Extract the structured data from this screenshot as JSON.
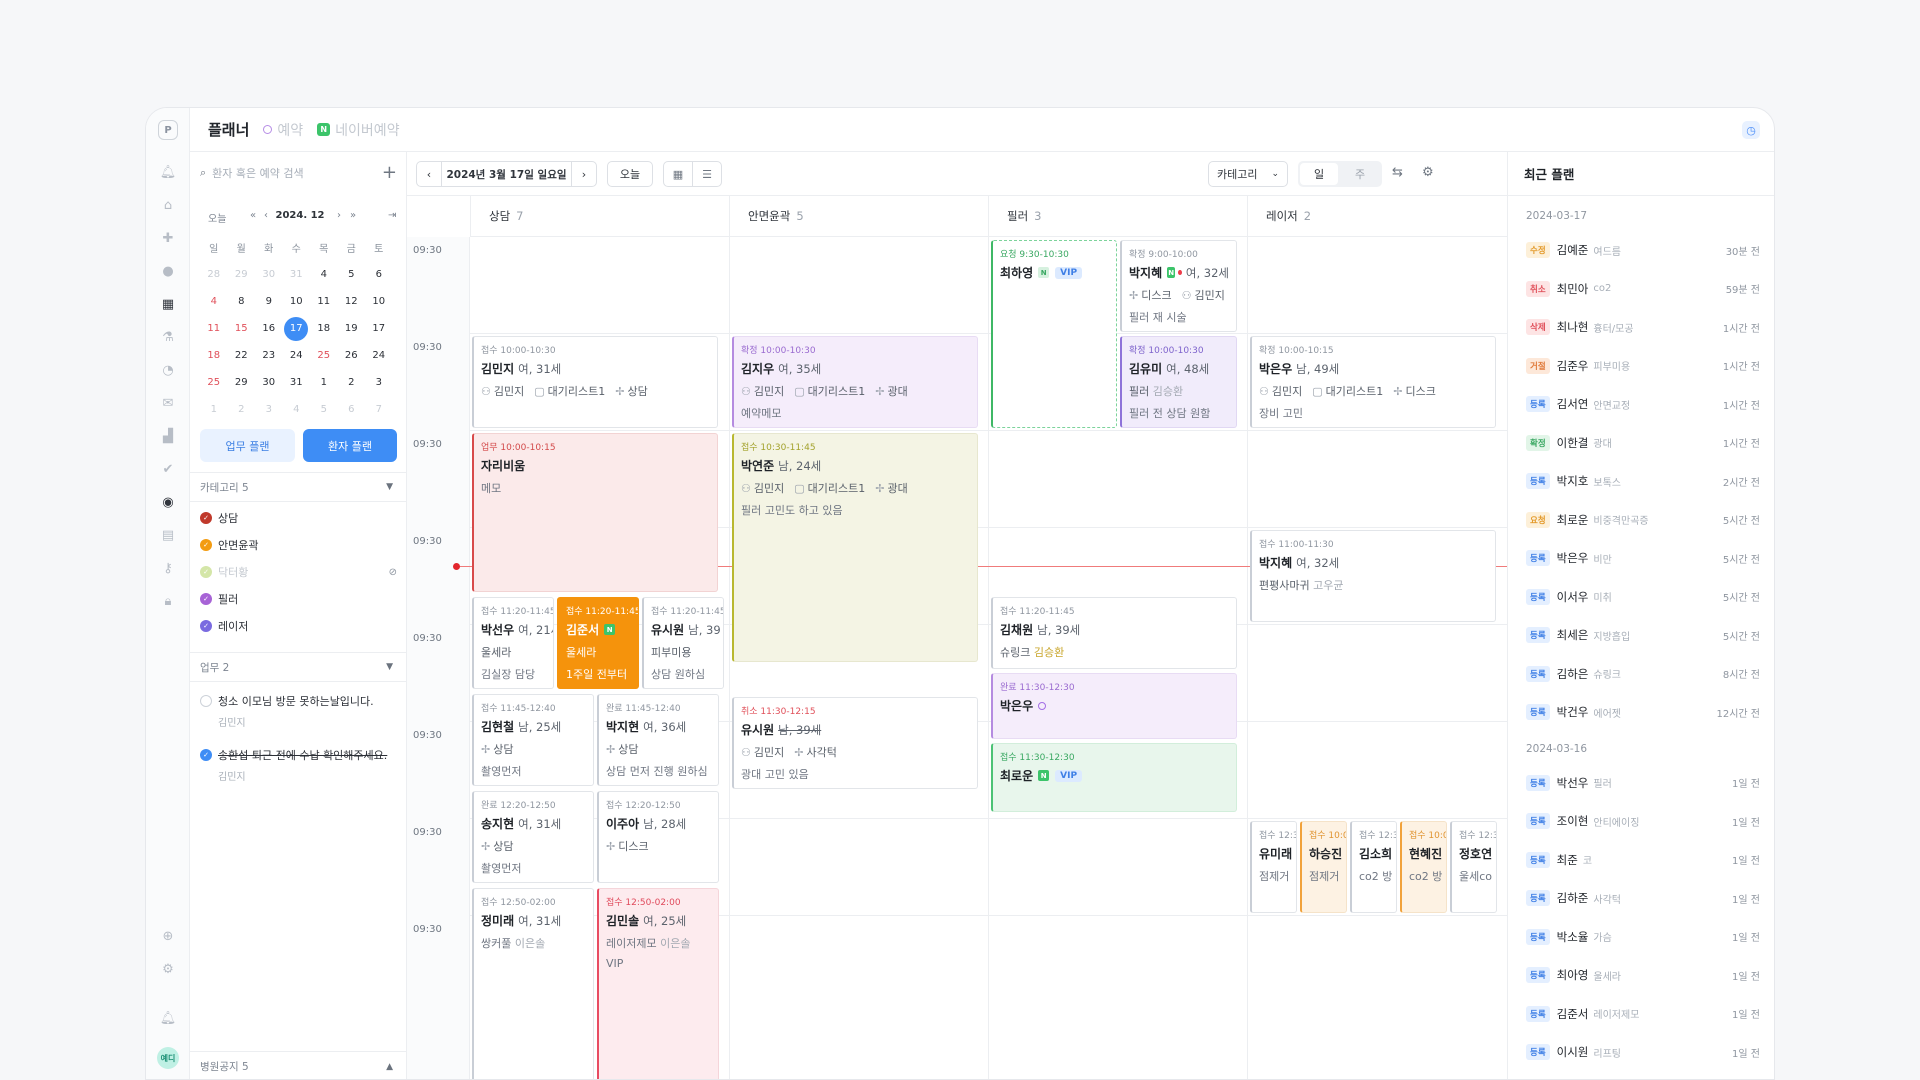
{
  "rail": {
    "logo": "P",
    "avatar": "예디"
  },
  "header": {
    "title": "플래너",
    "tab_reservation": "예약",
    "tab_naver": "네이버예약",
    "naver_letter": "N"
  },
  "search": {
    "placeholder": "환자 혹은 예약 검색",
    "plus": "+"
  },
  "calendar": {
    "today": "오늘",
    "prev_year": "«",
    "prev_month": "‹",
    "month": "2024. 12",
    "next_month": "›",
    "next_year": "»",
    "last": "⇥",
    "weekdays": [
      "일",
      "월",
      "화",
      "수",
      "목",
      "금",
      "토"
    ],
    "weeks": [
      [
        "28",
        "29",
        "30",
        "31",
        "4",
        "5",
        "6"
      ],
      [
        "4",
        "8",
        "9",
        "10",
        "11",
        "12",
        "10"
      ],
      [
        "11",
        "15",
        "16",
        "17",
        "18",
        "19",
        "17"
      ],
      [
        "18",
        "22",
        "23",
        "24",
        "25",
        "26",
        "24"
      ],
      [
        "25",
        "29",
        "30",
        "31",
        "1",
        "2",
        "3"
      ],
      [
        "1",
        "2",
        "3",
        "4",
        "5",
        "6",
        "7"
      ]
    ]
  },
  "plan_buttons": {
    "work": "업무 플랜",
    "patient": "환자 플랜"
  },
  "categories_section": {
    "title": "카테고리 5",
    "items": [
      {
        "label": "상담",
        "color": "#c0392b"
      },
      {
        "label": "안면윤곽",
        "color": "#f39c12"
      },
      {
        "label": "닥터황",
        "color": "#d4e6a8"
      },
      {
        "label": "필러",
        "color": "#a763d6"
      },
      {
        "label": "레이저",
        "color": "#7a6be0"
      }
    ]
  },
  "work_section": {
    "title": "업무 2",
    "items": [
      {
        "text": "청소 이모님 방문 못하는날입니다.",
        "sub": "김민지"
      },
      {
        "text": "송환섭 퇴근 전에 수납 확인해주세요.",
        "sub": "김민지"
      }
    ]
  },
  "notice_section": {
    "title": "병원공지 5"
  },
  "toolbar": {
    "prev": "‹",
    "date": "2024년 3월 17일 일요일",
    "next": "›",
    "today": "오늘",
    "category": "카테고리",
    "day": "일",
    "week": "주"
  },
  "columns": [
    {
      "name": "상담",
      "count": "7"
    },
    {
      "name": "안면윤곽",
      "count": "5"
    },
    {
      "name": "필러",
      "count": "3"
    },
    {
      "name": "레이저",
      "count": "2"
    }
  ],
  "time_labels": [
    "09:30",
    "09:30",
    "09:30",
    "09:30",
    "09:30",
    "09:30",
    "09:30",
    "09:30"
  ],
  "cards": {
    "c1": {
      "st": "접수 10:00-10:30",
      "nm": "김민지",
      "info": "여, 31세",
      "a": "김민지",
      "b": "대기리스트1",
      "c": "상담"
    },
    "c2": {
      "st": "업무 10:00-10:15",
      "nm": "자리비움",
      "memo": "메모"
    },
    "c3": {
      "st": "접수 11:20-11:45",
      "nm": "박선우",
      "info": "여, 21세",
      "r1": "울세라",
      "r2": "김실장 담당"
    },
    "c4": {
      "st": "접수 11:20-11:45",
      "nm": "김준서",
      "r1": "울세라",
      "r2": "1주일 전부터"
    },
    "c5": {
      "st": "접수 11:20-11:45",
      "nm": "유시원",
      "info": "남, 39",
      "r1": "피부미용",
      "r2": "상담 원하심"
    },
    "c6": {
      "st": "접수 11:45-12:40",
      "nm": "김현철",
      "info": "남, 25세",
      "c": "상담",
      "memo": "촬영먼저"
    },
    "c7": {
      "st": "완료 11:45-12:40",
      "nm": "박지현",
      "info": "여, 36세",
      "c": "상담",
      "memo": "상담 먼저 진행 원하심"
    },
    "c8": {
      "st": "완료 12:20-12:50",
      "nm": "송지현",
      "info": "여, 31세",
      "c": "상담",
      "memo": "촬영먼저"
    },
    "c9": {
      "st": "접수 12:20-12:50",
      "nm": "이주아",
      "info": "남, 28세",
      "c": "디스크"
    },
    "c10": {
      "st": "접수 12:50-02:00",
      "nm": "정미래",
      "info": "여, 31세",
      "memo": "쌍커풀",
      "who": "이은솔"
    },
    "c11": {
      "st": "접수 12:50-02:00",
      "nm": "김민솔",
      "info": "여, 25세",
      "memo": "레이저제모",
      "who": "이은솔",
      "extra": "VIP"
    },
    "d1": {
      "st": "확정 10:00-10:30",
      "nm": "김지우",
      "info": "여, 35세",
      "a": "김민지",
      "b": "대기리스트1",
      "c": "광대",
      "memo": "예약메모"
    },
    "d2": {
      "st": "접수 10:30-11:45",
      "nm": "박연준",
      "info": "남, 24세",
      "a": "김민지",
      "b": "대기리스트1",
      "c": "광대",
      "memo": "필러 고민도 하고 있음"
    },
    "d3": {
      "st": "취소 11:30-12:15",
      "nm": "유시원",
      "info": "남, 39세",
      "a": "김민지",
      "c": "사각턱",
      "memo": "광대 고민 있음"
    },
    "e1": {
      "st": "요청 9:30-10:30",
      "nm": "최하영",
      "vip": "VIP"
    },
    "e2": {
      "st": "확정 9:00-10:00",
      "nm": "박지혜",
      "info": "여, 32세",
      "c": "디스크",
      "a": "김민지",
      "memo": "필러 재 시술"
    },
    "e3": {
      "st": "확정 10:00-10:30",
      "nm": "김유미",
      "info": "여, 48세",
      "r1": "필러",
      "r1b": "김승환",
      "memo": "필러 전 상담 원함"
    },
    "e4": {
      "st": "접수 11:20-11:45",
      "nm": "김채원",
      "info": "남, 39세",
      "r1": "슈링크",
      "r1b": "김승환"
    },
    "e5": {
      "st": "완료 11:30-12:30",
      "nm": "박은우"
    },
    "e6": {
      "st": "접수 11:30-12:30",
      "nm": "최로운",
      "vip": "VIP"
    },
    "f1": {
      "st": "확정 10:00-10:15",
      "nm": "박은우",
      "info": "남, 49세",
      "a": "김민지",
      "b": "대기리스트1",
      "c": "디스크",
      "memo": "장비 고민"
    },
    "f2": {
      "st": "접수 11:00-11:30",
      "nm": "박지혜",
      "info": "여, 32세",
      "memo": "편평사마귀",
      "who": "고우균"
    },
    "g1": {
      "st": "접수 12:3",
      "nm": "유미래",
      "r1": "점제거"
    },
    "g2": {
      "st": "접수 10:0",
      "nm": "하승진",
      "r1": "점제거"
    },
    "g3": {
      "st": "접수 12:3",
      "nm": "김소희",
      "r1": "co2 방"
    },
    "g4": {
      "st": "접수 10:0",
      "nm": "현혜진",
      "r1": "co2 방"
    },
    "g5": {
      "st": "접수 12:3",
      "nm": "정호연",
      "r1": "울세co"
    }
  },
  "recent": {
    "title": "최근 플랜",
    "groups": [
      {
        "date": "2024-03-17",
        "items": [
          {
            "tag": "수정",
            "name": "김예준",
            "txt": "여드름",
            "ago": "30분 전"
          },
          {
            "tag": "취소",
            "name": "최민아",
            "txt": "co2",
            "ago": "59분 전"
          },
          {
            "tag": "삭제",
            "name": "최나현",
            "txt": "흉터/모공",
            "ago": "1시간 전"
          },
          {
            "tag": "거절",
            "name": "김준우",
            "txt": "피부미용",
            "ago": "1시간 전"
          },
          {
            "tag": "등록",
            "name": "김서연",
            "txt": "안면교정",
            "ago": "1시간 전"
          },
          {
            "tag": "확정",
            "name": "이한결",
            "txt": "광대",
            "ago": "1시간 전"
          },
          {
            "tag": "등록",
            "name": "박지호",
            "txt": "보톡스",
            "ago": "2시간 전"
          },
          {
            "tag": "요청",
            "name": "최로운",
            "txt": "비중격만곡증",
            "ago": "5시간 전"
          },
          {
            "tag": "등록",
            "name": "박은우",
            "txt": "비만",
            "ago": "5시간 전"
          },
          {
            "tag": "등록",
            "name": "이서우",
            "txt": "미취",
            "ago": "5시간 전"
          },
          {
            "tag": "등록",
            "name": "최세은",
            "txt": "지방흡입",
            "ago": "5시간 전"
          },
          {
            "tag": "등록",
            "name": "김하은",
            "txt": "슈링크",
            "ago": "8시간 전"
          },
          {
            "tag": "등록",
            "name": "박건우",
            "txt": "에어젯",
            "ago": "12시간 전"
          }
        ]
      },
      {
        "date": "2024-03-16",
        "items": [
          {
            "tag": "등록",
            "name": "박선우",
            "txt": "필러",
            "ago": "1일 전"
          },
          {
            "tag": "등록",
            "name": "조이현",
            "txt": "안티에이징",
            "ago": "1일 전"
          },
          {
            "tag": "등록",
            "name": "최준",
            "txt": "코",
            "ago": "1일 전"
          },
          {
            "tag": "등록",
            "name": "김하준",
            "txt": "사각턱",
            "ago": "1일 전"
          },
          {
            "tag": "등록",
            "name": "박소율",
            "txt": "가슴",
            "ago": "1일 전"
          },
          {
            "tag": "등록",
            "name": "최아영",
            "txt": "울세라",
            "ago": "1일 전"
          },
          {
            "tag": "등록",
            "name": "김준서",
            "txt": "레이저제모",
            "ago": "1일 전"
          },
          {
            "tag": "등록",
            "name": "이시원",
            "txt": "리프팅",
            "ago": "1일 전"
          }
        ]
      }
    ]
  },
  "colors": {
    "accent": "#3e8df5",
    "now_line": "#f07b7b"
  }
}
